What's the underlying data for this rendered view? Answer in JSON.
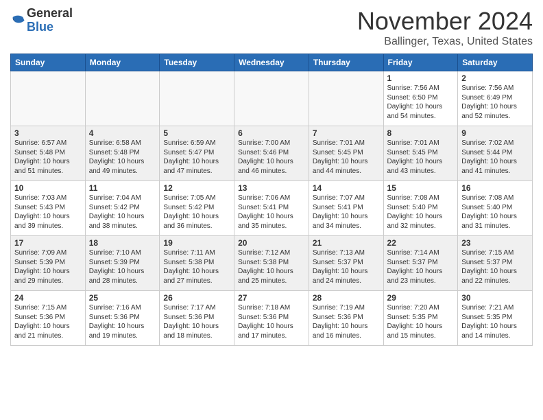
{
  "header": {
    "logo_general": "General",
    "logo_blue": "Blue",
    "month_title": "November 2024",
    "location": "Ballinger, Texas, United States"
  },
  "days_of_week": [
    "Sunday",
    "Monday",
    "Tuesday",
    "Wednesday",
    "Thursday",
    "Friday",
    "Saturday"
  ],
  "weeks": [
    {
      "cells": [
        {
          "day": "",
          "info": ""
        },
        {
          "day": "",
          "info": ""
        },
        {
          "day": "",
          "info": ""
        },
        {
          "day": "",
          "info": ""
        },
        {
          "day": "",
          "info": ""
        },
        {
          "day": "1",
          "info": "Sunrise: 7:56 AM\nSunset: 6:50 PM\nDaylight: 10 hours and 54 minutes."
        },
        {
          "day": "2",
          "info": "Sunrise: 7:56 AM\nSunset: 6:49 PM\nDaylight: 10 hours and 52 minutes."
        }
      ]
    },
    {
      "cells": [
        {
          "day": "3",
          "info": "Sunrise: 6:57 AM\nSunset: 5:48 PM\nDaylight: 10 hours and 51 minutes."
        },
        {
          "day": "4",
          "info": "Sunrise: 6:58 AM\nSunset: 5:48 PM\nDaylight: 10 hours and 49 minutes."
        },
        {
          "day": "5",
          "info": "Sunrise: 6:59 AM\nSunset: 5:47 PM\nDaylight: 10 hours and 47 minutes."
        },
        {
          "day": "6",
          "info": "Sunrise: 7:00 AM\nSunset: 5:46 PM\nDaylight: 10 hours and 46 minutes."
        },
        {
          "day": "7",
          "info": "Sunrise: 7:01 AM\nSunset: 5:45 PM\nDaylight: 10 hours and 44 minutes."
        },
        {
          "day": "8",
          "info": "Sunrise: 7:01 AM\nSunset: 5:45 PM\nDaylight: 10 hours and 43 minutes."
        },
        {
          "day": "9",
          "info": "Sunrise: 7:02 AM\nSunset: 5:44 PM\nDaylight: 10 hours and 41 minutes."
        }
      ]
    },
    {
      "cells": [
        {
          "day": "10",
          "info": "Sunrise: 7:03 AM\nSunset: 5:43 PM\nDaylight: 10 hours and 39 minutes."
        },
        {
          "day": "11",
          "info": "Sunrise: 7:04 AM\nSunset: 5:42 PM\nDaylight: 10 hours and 38 minutes."
        },
        {
          "day": "12",
          "info": "Sunrise: 7:05 AM\nSunset: 5:42 PM\nDaylight: 10 hours and 36 minutes."
        },
        {
          "day": "13",
          "info": "Sunrise: 7:06 AM\nSunset: 5:41 PM\nDaylight: 10 hours and 35 minutes."
        },
        {
          "day": "14",
          "info": "Sunrise: 7:07 AM\nSunset: 5:41 PM\nDaylight: 10 hours and 34 minutes."
        },
        {
          "day": "15",
          "info": "Sunrise: 7:08 AM\nSunset: 5:40 PM\nDaylight: 10 hours and 32 minutes."
        },
        {
          "day": "16",
          "info": "Sunrise: 7:08 AM\nSunset: 5:40 PM\nDaylight: 10 hours and 31 minutes."
        }
      ]
    },
    {
      "cells": [
        {
          "day": "17",
          "info": "Sunrise: 7:09 AM\nSunset: 5:39 PM\nDaylight: 10 hours and 29 minutes."
        },
        {
          "day": "18",
          "info": "Sunrise: 7:10 AM\nSunset: 5:39 PM\nDaylight: 10 hours and 28 minutes."
        },
        {
          "day": "19",
          "info": "Sunrise: 7:11 AM\nSunset: 5:38 PM\nDaylight: 10 hours and 27 minutes."
        },
        {
          "day": "20",
          "info": "Sunrise: 7:12 AM\nSunset: 5:38 PM\nDaylight: 10 hours and 25 minutes."
        },
        {
          "day": "21",
          "info": "Sunrise: 7:13 AM\nSunset: 5:37 PM\nDaylight: 10 hours and 24 minutes."
        },
        {
          "day": "22",
          "info": "Sunrise: 7:14 AM\nSunset: 5:37 PM\nDaylight: 10 hours and 23 minutes."
        },
        {
          "day": "23",
          "info": "Sunrise: 7:15 AM\nSunset: 5:37 PM\nDaylight: 10 hours and 22 minutes."
        }
      ]
    },
    {
      "cells": [
        {
          "day": "24",
          "info": "Sunrise: 7:15 AM\nSunset: 5:36 PM\nDaylight: 10 hours and 21 minutes."
        },
        {
          "day": "25",
          "info": "Sunrise: 7:16 AM\nSunset: 5:36 PM\nDaylight: 10 hours and 19 minutes."
        },
        {
          "day": "26",
          "info": "Sunrise: 7:17 AM\nSunset: 5:36 PM\nDaylight: 10 hours and 18 minutes."
        },
        {
          "day": "27",
          "info": "Sunrise: 7:18 AM\nSunset: 5:36 PM\nDaylight: 10 hours and 17 minutes."
        },
        {
          "day": "28",
          "info": "Sunrise: 7:19 AM\nSunset: 5:36 PM\nDaylight: 10 hours and 16 minutes."
        },
        {
          "day": "29",
          "info": "Sunrise: 7:20 AM\nSunset: 5:35 PM\nDaylight: 10 hours and 15 minutes."
        },
        {
          "day": "30",
          "info": "Sunrise: 7:21 AM\nSunset: 5:35 PM\nDaylight: 10 hours and 14 minutes."
        }
      ]
    }
  ]
}
